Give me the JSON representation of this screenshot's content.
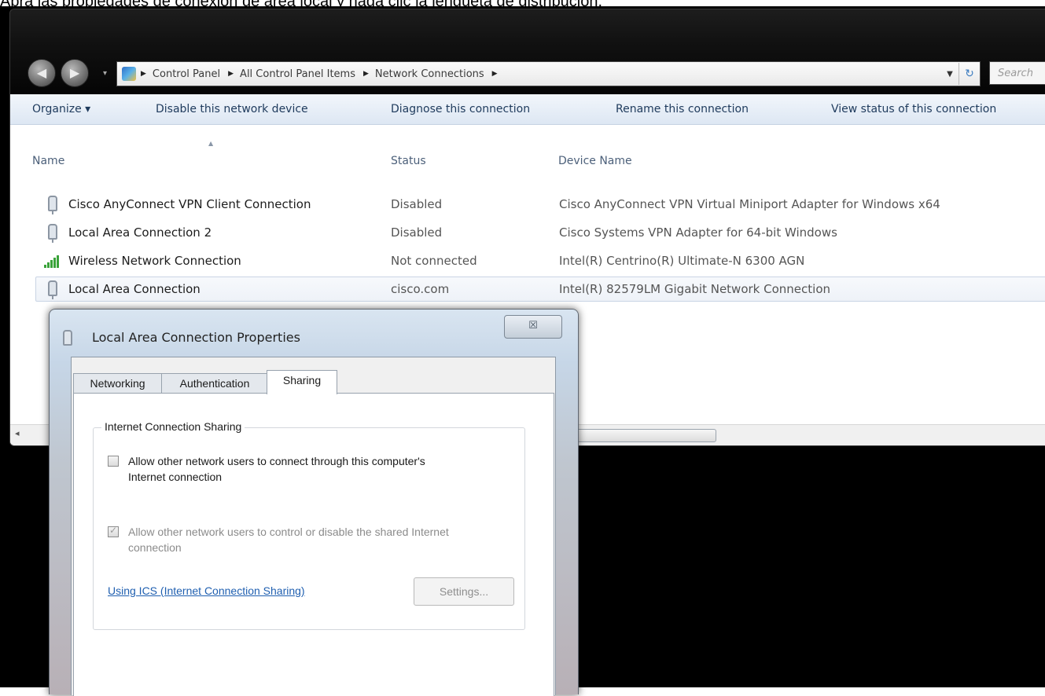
{
  "caption": "Abra las propiedades de conexión de área local y haga clic la lengüeta de distribución.",
  "explorer": {
    "nav": {
      "back_glyph": "◀",
      "forward_glyph": "▶",
      "dropdown_glyph": "▾"
    },
    "breadcrumb": [
      "Control Panel",
      "All Control Panel Items",
      "Network Connections"
    ],
    "search_placeholder": "Search",
    "toolbar": {
      "organize": "Organize ▾",
      "disable": "Disable this network device",
      "diagnose": "Diagnose this connection",
      "rename": "Rename this connection",
      "view_status": "View status of this connection"
    },
    "columns": {
      "name": "Name",
      "status": "Status",
      "device": "Device Name"
    },
    "connections": [
      {
        "icon": "network-adapter-icon",
        "name": "Cisco AnyConnect VPN Client Connection",
        "status": "Disabled",
        "device": "Cisco AnyConnect VPN Virtual Miniport Adapter for Windows x64"
      },
      {
        "icon": "network-adapter-icon",
        "name": "Local Area Connection 2",
        "status": "Disabled",
        "device": "Cisco Systems VPN Adapter for 64-bit Windows"
      },
      {
        "icon": "wifi-signal-icon",
        "name": "Wireless Network Connection",
        "status": "Not connected",
        "device": "Intel(R) Centrino(R) Ultimate-N 6300 AGN"
      },
      {
        "icon": "network-adapter-icon",
        "name": "Local Area Connection",
        "status": "cisco.com",
        "device": "Intel(R) 82579LM Gigabit Network Connection",
        "selected": true
      }
    ]
  },
  "dialog": {
    "title": "Local Area Connection Properties",
    "close_glyph": "☒",
    "tabs": [
      "Networking",
      "Authentication",
      "Sharing"
    ],
    "active_tab": "Sharing",
    "group_title": "Internet Connection Sharing",
    "checkbox1": {
      "label": "Allow other network users to connect through this computer's Internet connection",
      "checked": false
    },
    "checkbox2": {
      "label": "Allow other network users to control or disable the shared Internet connection",
      "checked": true,
      "disabled": true
    },
    "link": "Using ICS (Internet Connection Sharing)",
    "settings_button": "Settings..."
  }
}
